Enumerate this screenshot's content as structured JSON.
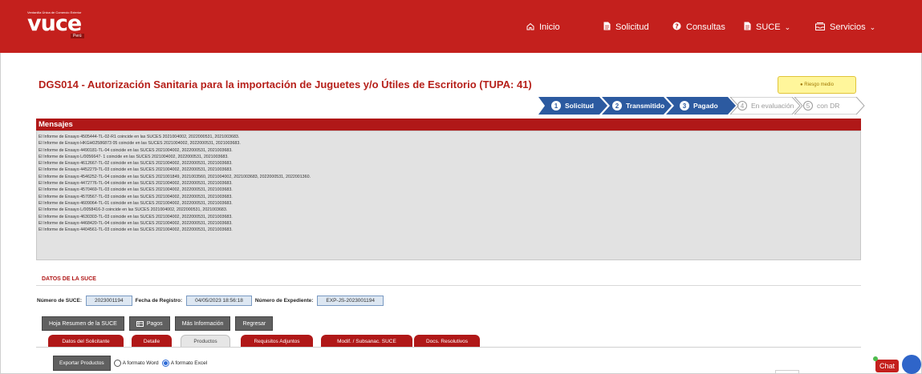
{
  "header": {
    "logo_top": "Ventanilla Única de Comercio Exterior",
    "logo_main": "vuce",
    "logo_sub": "Perú",
    "nav": [
      {
        "label": "Inicio",
        "icon": "home-icon"
      },
      {
        "label": "Solicitud",
        "icon": "document-icon"
      },
      {
        "label": "Consultas",
        "icon": "help-icon"
      },
      {
        "label": "SUCE",
        "icon": "document-icon",
        "dropdown": true
      },
      {
        "label": "Servicios",
        "icon": "inbox-icon",
        "dropdown": true
      }
    ]
  },
  "page": {
    "title": "DGS014 - Autorización Sanitaria para la importación de Juguetes y/o Útiles de Escritorio (TUPA: 41)",
    "risk_badge": "● Riesgo medio"
  },
  "stepper": [
    {
      "num": "1",
      "label": "Solicitud",
      "state": "done"
    },
    {
      "num": "2",
      "label": "Transmitido",
      "state": "done"
    },
    {
      "num": "3",
      "label": "Pagado",
      "state": "done"
    },
    {
      "num": "4",
      "label": "En evaluación",
      "state": "todo"
    },
    {
      "num": "5",
      "label": "con DR",
      "state": "todo"
    }
  ],
  "mensajes": {
    "title": "Mensajes",
    "lines": [
      "El Informe de Ensayo 4505444-TL-02-R1 coincide en las SUCES 2021004002, 2022000531, 2021003683.",
      "El Informe de Ensayo HKGH02586873 05 coincide en las SUCES 2021004002, 2022000531, 2021003683.",
      "El Informe de Ensayo 4490181-TL-04 coincide en las SUCES 2021004002, 2022000531, 2021003683.",
      "El Informe de Ensayo L/0056647- 1 coincide en las SUCES 2021004002, 2022000531, 2021003683.",
      "El Informe de Ensayo 4612667-TL-02 coincide en las SUCES 2021004002, 2022000531, 2021003683.",
      "El Informe de Ensayo 4452279-TL-03 coincide en las SUCES 2021004002, 2022000531, 2021003683.",
      "El Informe de Ensayo 4546252-TL-04 coincide en las SUCES 2021001849, 2021003560, 2021004002, 2021003683, 2022000531, 2022001360.",
      "El Informe de Ensayo 4472776-TL-04 coincide en las SUCES 2021004002, 2022000531, 2021003683.",
      "El Informe de Ensayo 4570469-TL-03 coincide en las SUCES 2021004002, 2022000531, 2021003683.",
      "El Informe de Ensayo 4570567-TL-03 coincide en las SUCES 2021004002, 2022000531, 2021003683.",
      "El Informe de Ensayo 4609064-TL-01 coincide en las SUCES 2021004002, 2022000531, 2021003683.",
      "El Informe de Ensayo L/0058416-3 coincide en las SUCES 2021004002, 2022000531, 2021003683.",
      "El Informe de Ensayo 4630303-TL-03 coincide en las SUCES 2021004002, 2022000531, 2021003683.",
      "El Informe de Ensayo 4468420-TL-04 coincide en las SUCES 2021004002, 2022000531, 2021003683.",
      "El Informe de Ensayo 4404561-TL-03 coincide en las SUCES 2021004002, 2022000531, 2021003683."
    ]
  },
  "datos": {
    "section_title": "DATOS DE LA SUCE",
    "numero_suce_label": "Número de SUCE:",
    "numero_suce": "2023001194",
    "fecha_label": "Fecha de Registro:",
    "fecha": "04/05/2023 18:56:18",
    "expediente_label": "Número de Expediente:",
    "expediente": "EXP-JS-2023001194"
  },
  "buttons": {
    "hoja": "Hoja Resumen de la SUCE",
    "pagos": "Pagos",
    "mas": "Más Información",
    "regresar": "Regresar"
  },
  "tabs": [
    "Datos del Solicitante",
    "Detalle",
    "Productos",
    "Requisitos Adjuntos",
    "Modif. / Subsanac. SUCE",
    "Docs. Resolutivos"
  ],
  "active_tab": "Productos",
  "export": {
    "button": "Exportar Productos",
    "opt_word": "A formato Word",
    "opt_excel": "A formato Excel",
    "selected": "A formato Excel"
  },
  "chat": {
    "label": "Chat"
  },
  "colors": {
    "brand_red": "#c4201d",
    "step_blue": "#2c5aa0",
    "risk_yellow": "#fff69b"
  }
}
